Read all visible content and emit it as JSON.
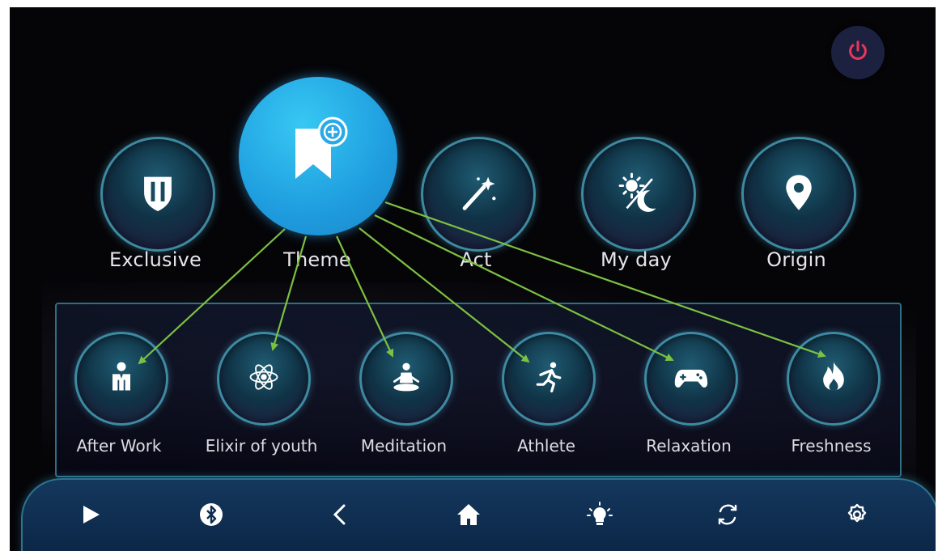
{
  "power": {
    "icon": "power-icon",
    "color": "#e8375c"
  },
  "categories": [
    {
      "label": "Exclusive",
      "icon": "shield-icon"
    },
    {
      "label": "Theme",
      "icon": "bookmark-add-icon",
      "selected": true
    },
    {
      "label": "Act",
      "icon": "magic-wand-icon"
    },
    {
      "label": "My day",
      "icon": "day-night-icon"
    },
    {
      "label": "Origin",
      "icon": "location-pin-icon"
    }
  ],
  "themes": [
    {
      "label": "After Work",
      "icon": "person-suit-icon"
    },
    {
      "label": "Elixir of youth",
      "icon": "atom-icon"
    },
    {
      "label": "Meditation",
      "icon": "meditation-icon"
    },
    {
      "label": "Athlete",
      "icon": "runner-icon"
    },
    {
      "label": "Relaxation",
      "icon": "gamepad-icon"
    },
    {
      "label": "Freshness",
      "icon": "flame-icon"
    }
  ],
  "nav": [
    {
      "icon": "play-icon"
    },
    {
      "icon": "bluetooth-icon"
    },
    {
      "icon": "back-icon"
    },
    {
      "icon": "home-icon"
    },
    {
      "icon": "light-bulb-icon"
    },
    {
      "icon": "sync-icon"
    },
    {
      "icon": "settings-icon"
    }
  ],
  "colors": {
    "accent_blue": "#1f9ddf",
    "ring": "#3d8aa3",
    "annotation_arrow": "#7dc142",
    "background": "#050508"
  }
}
